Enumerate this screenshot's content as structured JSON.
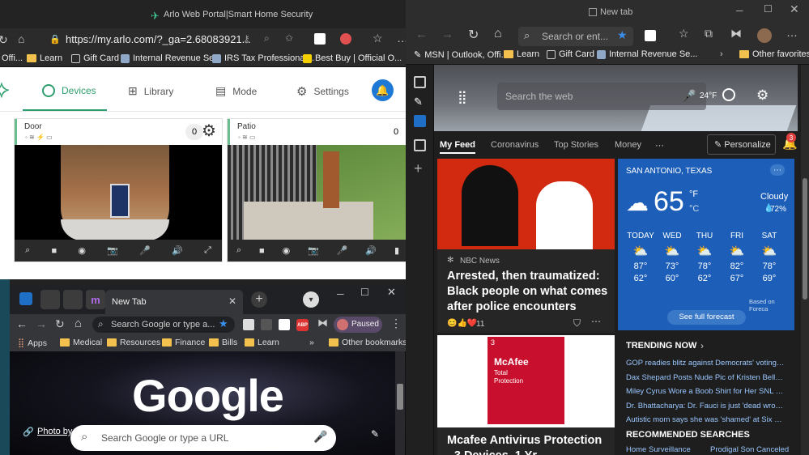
{
  "arlo": {
    "window_title": "Arlo Web Portal|Smart Home Security",
    "url": "https://my.arlo.com/?_ga=2.68083921...",
    "favorites": [
      {
        "label": "Offi...",
        "icon": "office-icon"
      },
      {
        "label": "Learn",
        "icon": "folder-icon"
      },
      {
        "label": "Gift Card",
        "icon": "page-icon"
      },
      {
        "label": "Internal Revenue Se...",
        "icon": "irs-icon"
      },
      {
        "label": "IRS Tax Professional...",
        "icon": "irs-icon"
      },
      {
        "label": "Best Buy | Official O...",
        "icon": "bestbuy-icon"
      }
    ],
    "nav": {
      "devices": "Devices",
      "library": "Library",
      "mode": "Mode",
      "settings": "Settings"
    },
    "cameras": [
      {
        "name": "Door",
        "count": "0"
      },
      {
        "name": "Patio",
        "count": "0"
      }
    ]
  },
  "edge": {
    "tab_title": "New tab",
    "search_placeholder": "Search or ent...",
    "favorites": [
      {
        "label": "MSN | Outlook, Offi...",
        "icon": "msn-icon"
      },
      {
        "label": "Learn",
        "icon": "folder-icon"
      },
      {
        "label": "Gift Card",
        "icon": "page-icon"
      },
      {
        "label": "Internal Revenue Se...",
        "icon": "irs-icon"
      },
      {
        "label": "Other favorites",
        "icon": "folder-icon"
      }
    ],
    "web_search_placeholder": "Search the web",
    "temp_badge": "24°F",
    "feed_tabs": [
      "My Feed",
      "Coronavirus",
      "Top Stories",
      "Money"
    ],
    "personalize": "Personalize",
    "notif_count": "3",
    "news": {
      "source": "NBC News",
      "headline": "Arrested, then traumatized: Black people on what comes after police encounters",
      "reactions": "11"
    },
    "ad": {
      "headline": "Mcafee Antivirus Protection - 3 Devices, 1 Yr",
      "product_brand": "McAfee",
      "product_line1": "Total",
      "product_line2": "Protection",
      "product_count": "3"
    },
    "weather": {
      "location": "SAN ANTONIO, TEXAS",
      "temp": "65",
      "unit_f": "°F",
      "unit_c": "°C",
      "condition": "Cloudy",
      "precip": "72%",
      "days": [
        {
          "d": "TODAY",
          "hi": "87°",
          "lo": "62°"
        },
        {
          "d": "WED",
          "hi": "73°",
          "lo": "60°"
        },
        {
          "d": "THU",
          "hi": "78°",
          "lo": "62°"
        },
        {
          "d": "FRI",
          "hi": "82°",
          "lo": "67°"
        },
        {
          "d": "SAT",
          "hi": "78°",
          "lo": "69°"
        }
      ],
      "based_on": "Based on Foreca",
      "forecast_button": "See full forecast"
    },
    "trending_title": "TRENDING NOW",
    "trending": [
      "GOP readies blitz against Democrats' voting righ...",
      "Dax Shepard Posts Nude Pic of Kristen Bell: 'Look...",
      "Miley Cyrus Wore a Boob Shirt for Her SNL Perfo...",
      "Dr. Bhattacharya: Dr. Fauci is just 'dead wrong'",
      "Autistic mom says she was 'shamed' at Six Flags ..."
    ],
    "recommended_title": "RECOMMENDED SEARCHES",
    "recommended": [
      "Home Surveillance",
      "Prodigal Son Canceled"
    ]
  },
  "chrome": {
    "tab_title": "New Tab",
    "omnibox_placeholder": "Search Google or type a...",
    "paused": "Paused",
    "bookmarks": [
      "Apps",
      "Medical",
      "Resources",
      "Finance",
      "Bills",
      "Learn"
    ],
    "other_bookmarks": "Other bookmarks",
    "logo": "Google",
    "search_placeholder": "Search Google or type a URL",
    "photo_by": "Photo by"
  },
  "colors": {
    "arlo_accent": "#2f9e6e",
    "arlo_blue": "#1d78d6",
    "edge_weather_bg": "#1d5fb8",
    "edge_link": "#9ac7ff"
  }
}
